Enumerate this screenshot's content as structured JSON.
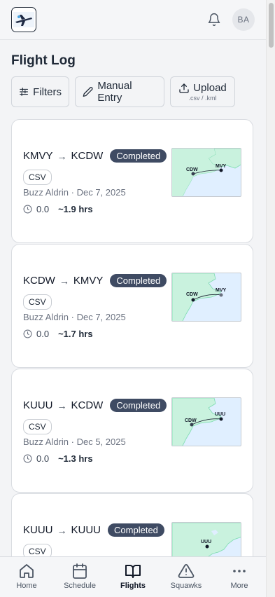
{
  "header": {
    "avatar_initials": "BA"
  },
  "page": {
    "title": "Flight Log"
  },
  "actions": {
    "filters_label": "Filters",
    "manual_label": "Manual Entry",
    "upload_label": "Upload",
    "upload_sub": ".csv / .kml"
  },
  "flights": [
    {
      "from": "KMVY",
      "to": "KCDW",
      "status": "Completed",
      "source": "CSV",
      "pilot_date": "Buzz Aldrin · Dec 7, 2025",
      "value": "0.0",
      "duration": "~1.9 hrs",
      "map_a": "CDW",
      "map_b": "MVY"
    },
    {
      "from": "KCDW",
      "to": "KMVY",
      "status": "Completed",
      "source": "CSV",
      "pilot_date": "Buzz Aldrin · Dec 7, 2025",
      "value": "0.0",
      "duration": "~1.7 hrs",
      "map_a": "CDW",
      "map_b": "MVY"
    },
    {
      "from": "KUUU",
      "to": "KCDW",
      "status": "Completed",
      "source": "CSV",
      "pilot_date": "Buzz Aldrin · Dec 5, 2025",
      "value": "0.0",
      "duration": "~1.3 hrs",
      "map_a": "CDW",
      "map_b": "UUU"
    },
    {
      "from": "KUUU",
      "to": "KUUU",
      "status": "Completed",
      "source": "CSV",
      "map_b": "UUU"
    }
  ],
  "nav": {
    "home": "Home",
    "schedule": "Schedule",
    "flights": "Flights",
    "squawks": "Squawks",
    "more": "More"
  },
  "colors": {
    "badge": "#3f4b63",
    "map_water": "#e0efff",
    "map_land": "#c9f2de"
  }
}
